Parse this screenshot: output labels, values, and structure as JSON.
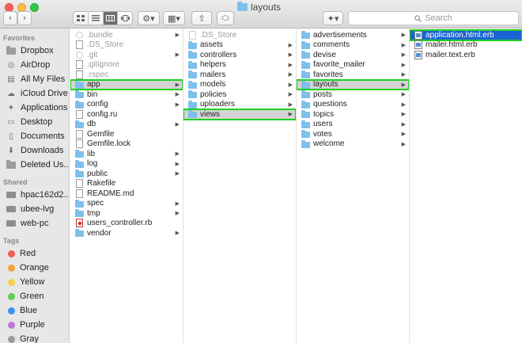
{
  "window": {
    "title": "layouts"
  },
  "toolbar": {
    "back_glyph": "‹",
    "forward_glyph": "›",
    "view_modes": [
      "icon-view",
      "list-view",
      "column-view",
      "cover-flow-view"
    ],
    "active_view": "column-view",
    "action_glyph": "⚙▾",
    "arrange_glyph": "▦▾",
    "share_glyph": "⇧",
    "tag_glyph": "⬭",
    "dropbox_glyph": "✦▾",
    "search_placeholder": "Search"
  },
  "sidebar": {
    "favorites_header": "Favorites",
    "favorites": [
      {
        "label": "Dropbox",
        "icon": "folder-icon"
      },
      {
        "label": "AirDrop",
        "icon": "airdrop-icon"
      },
      {
        "label": "All My Files",
        "icon": "all-files-icon"
      },
      {
        "label": "iCloud Drive",
        "icon": "cloud-icon"
      },
      {
        "label": "Applications",
        "icon": "applications-icon"
      },
      {
        "label": "Desktop",
        "icon": "desktop-icon"
      },
      {
        "label": "Documents",
        "icon": "documents-icon"
      },
      {
        "label": "Downloads",
        "icon": "download-icon"
      },
      {
        "label": "Deleted Us...",
        "icon": "folder-icon"
      }
    ],
    "shared_header": "Shared",
    "shared": [
      {
        "label": "hpac162d2...",
        "icon": "computer-icon"
      },
      {
        "label": "ubee-lvg",
        "icon": "computer-icon"
      },
      {
        "label": "web-pc",
        "icon": "computer-icon"
      }
    ],
    "tags_header": "Tags",
    "tags": [
      {
        "label": "Red",
        "color": "#f25e57"
      },
      {
        "label": "Orange",
        "color": "#f7a23b"
      },
      {
        "label": "Yellow",
        "color": "#f7d04a"
      },
      {
        "label": "Green",
        "color": "#5fcd55"
      },
      {
        "label": "Blue",
        "color": "#3f8ff0"
      },
      {
        "label": "Purple",
        "color": "#bc79d8"
      },
      {
        "label": "Gray",
        "color": "#9b9b9b"
      }
    ]
  },
  "columns": [
    {
      "items": [
        {
          "name": ".bundle",
          "kind": "circle",
          "dim": true,
          "chevron": true
        },
        {
          "name": ".DS_Store",
          "kind": "doc",
          "dim": true,
          "chevron": false
        },
        {
          "name": ".git",
          "kind": "circle",
          "dim": true,
          "chevron": true
        },
        {
          "name": ".gitignore",
          "kind": "doc",
          "dim": true,
          "chevron": false
        },
        {
          "name": ".rspec",
          "kind": "doc",
          "dim": true,
          "chevron": false
        },
        {
          "name": "app",
          "kind": "folder",
          "dim": false,
          "chevron": true,
          "selected": true
        },
        {
          "name": "bin",
          "kind": "folder",
          "dim": false,
          "chevron": true
        },
        {
          "name": "config",
          "kind": "folder",
          "dim": false,
          "chevron": true
        },
        {
          "name": "config.ru",
          "kind": "doc",
          "dim": false,
          "chevron": false
        },
        {
          "name": "db",
          "kind": "folder",
          "dim": false,
          "chevron": true
        },
        {
          "name": "Gemfile",
          "kind": "doc",
          "dim": false,
          "chevron": false
        },
        {
          "name": "Gemfile.lock",
          "kind": "doc",
          "dim": false,
          "chevron": false
        },
        {
          "name": "lib",
          "kind": "folder",
          "dim": false,
          "chevron": true
        },
        {
          "name": "log",
          "kind": "folder",
          "dim": false,
          "chevron": true
        },
        {
          "name": "public",
          "kind": "folder",
          "dim": false,
          "chevron": true
        },
        {
          "name": "Rakefile",
          "kind": "doc",
          "dim": false,
          "chevron": false
        },
        {
          "name": "README.md",
          "kind": "doc",
          "dim": false,
          "chevron": false
        },
        {
          "name": "spec",
          "kind": "folder",
          "dim": false,
          "chevron": true
        },
        {
          "name": "tmp",
          "kind": "folder",
          "dim": false,
          "chevron": true
        },
        {
          "name": "users_controller.rb",
          "kind": "ruby",
          "dim": false,
          "chevron": false
        },
        {
          "name": "vendor",
          "kind": "folder",
          "dim": false,
          "chevron": true
        }
      ]
    },
    {
      "items": [
        {
          "name": ".DS_Store",
          "kind": "doc-dim",
          "dim": true,
          "chevron": false
        },
        {
          "name": "assets",
          "kind": "folder",
          "dim": false,
          "chevron": true
        },
        {
          "name": "controllers",
          "kind": "folder",
          "dim": false,
          "chevron": true
        },
        {
          "name": "helpers",
          "kind": "folder",
          "dim": false,
          "chevron": true
        },
        {
          "name": "mailers",
          "kind": "folder",
          "dim": false,
          "chevron": true
        },
        {
          "name": "models",
          "kind": "folder",
          "dim": false,
          "chevron": true
        },
        {
          "name": "policies",
          "kind": "folder",
          "dim": false,
          "chevron": true
        },
        {
          "name": "uploaders",
          "kind": "folder",
          "dim": false,
          "chevron": true
        },
        {
          "name": "views",
          "kind": "folder",
          "dim": false,
          "chevron": true,
          "selected": true
        }
      ]
    },
    {
      "items": [
        {
          "name": "advertisements",
          "kind": "folder",
          "dim": false,
          "chevron": true
        },
        {
          "name": "comments",
          "kind": "folder",
          "dim": false,
          "chevron": true
        },
        {
          "name": "devise",
          "kind": "folder",
          "dim": false,
          "chevron": true
        },
        {
          "name": "favorite_mailer",
          "kind": "folder",
          "dim": false,
          "chevron": true
        },
        {
          "name": "favorites",
          "kind": "folder",
          "dim": false,
          "chevron": true
        },
        {
          "name": "layouts",
          "kind": "folder",
          "dim": false,
          "chevron": true,
          "selected": true
        },
        {
          "name": "posts",
          "kind": "folder",
          "dim": false,
          "chevron": true
        },
        {
          "name": "questions",
          "kind": "folder",
          "dim": false,
          "chevron": true
        },
        {
          "name": "topics",
          "kind": "folder",
          "dim": false,
          "chevron": true
        },
        {
          "name": "users",
          "kind": "folder",
          "dim": false,
          "chevron": true
        },
        {
          "name": "votes",
          "kind": "folder",
          "dim": false,
          "chevron": true
        },
        {
          "name": "welcome",
          "kind": "folder",
          "dim": false,
          "chevron": true
        }
      ]
    },
    {
      "items": [
        {
          "name": "application.html.erb",
          "kind": "erb",
          "dim": false,
          "chevron": false,
          "selected": true,
          "focused": true
        },
        {
          "name": "mailer.html.erb",
          "kind": "erb",
          "dim": false,
          "chevron": false
        },
        {
          "name": "mailer.text.erb",
          "kind": "erb",
          "dim": false,
          "chevron": false
        }
      ]
    }
  ]
}
